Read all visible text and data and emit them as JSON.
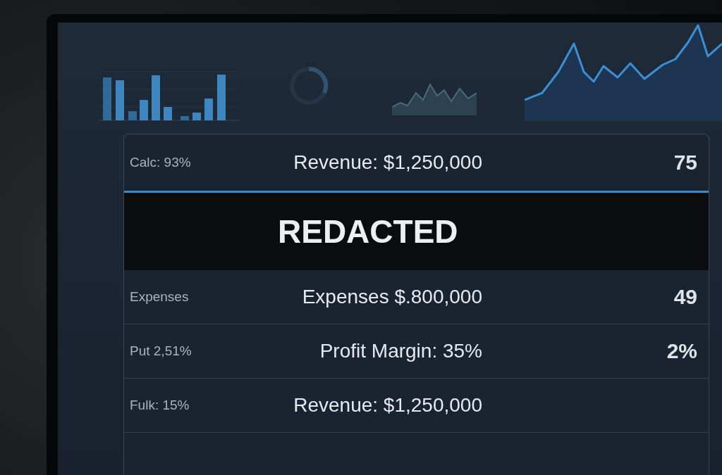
{
  "metrics_table": {
    "rows": [
      {
        "kind": "metric",
        "label": "Calc: 93%",
        "value": "Revenue: $1,250,000",
        "figure": "75"
      },
      {
        "kind": "redacted",
        "text": "REDACTED"
      },
      {
        "kind": "metric",
        "label": "Expenses",
        "value": "Expenses $.800,000",
        "figure": "49"
      },
      {
        "kind": "metric",
        "label": "Put 2,51%",
        "value": "Profit Margin: 35%",
        "figure": "2%"
      },
      {
        "kind": "metric",
        "label": "Fulk: 15%",
        "value": "Revenue: $1,250,000"
      }
    ]
  }
}
